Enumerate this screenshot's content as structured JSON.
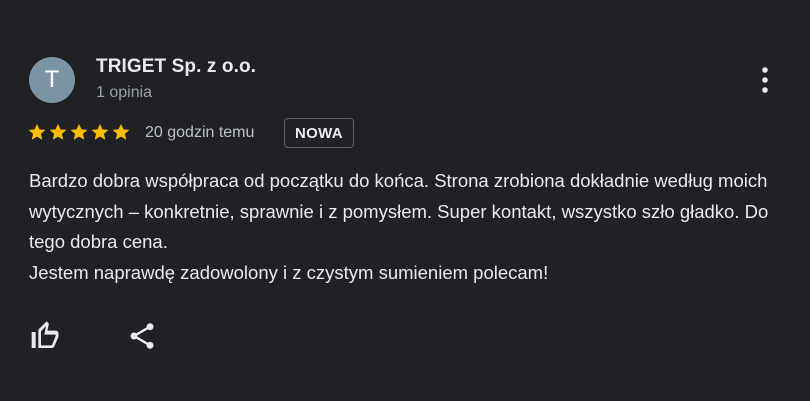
{
  "review": {
    "author": {
      "initial": "T",
      "name": "TRIGET Sp. z o.o.",
      "meta": "1 opinia",
      "avatar_color": "#7b94a5"
    },
    "rating": 5,
    "rating_max": 5,
    "star_color": "#fbbc04",
    "time_ago": "20 godzin temu",
    "badge": "NOWA",
    "text_paragraphs": [
      "Bardzo dobra współpraca od początku do końca. Strona zrobiona dokładnie według moich wytycznych – konkretnie, sprawnie i z pomysłem. Super kontakt, wszystko szło gładko. Do tego dobra cena.",
      "Jestem naprawdę zadowolony i z czystym sumieniem polecam!"
    ],
    "actions": {
      "more_icon": "more-vert-icon",
      "like_icon": "thumb-up-icon",
      "share_icon": "share-icon"
    }
  }
}
